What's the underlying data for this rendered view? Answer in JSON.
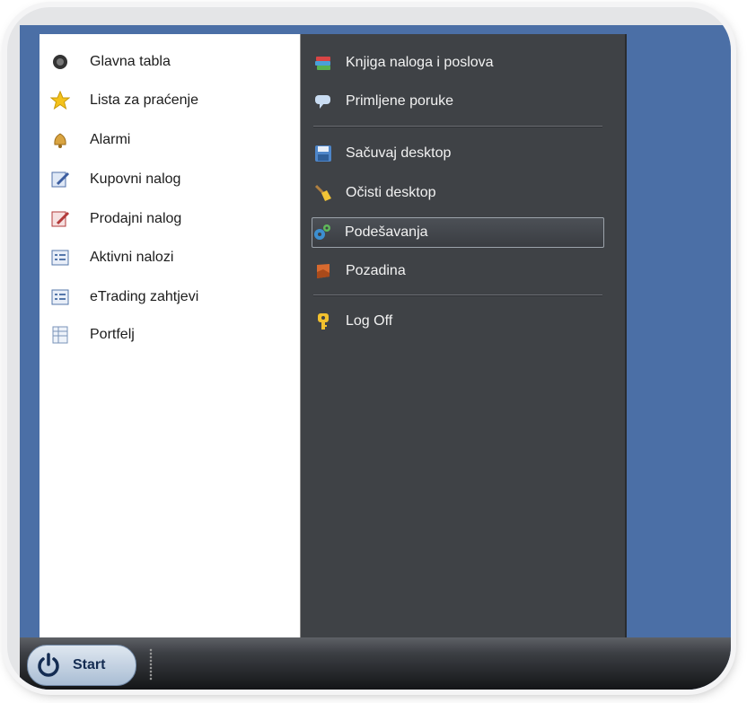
{
  "start_menu": {
    "left_items": [
      {
        "label": "Glavna tabla",
        "icon": "dashboard-icon"
      },
      {
        "label": "Lista za praćenje",
        "icon": "star-icon"
      },
      {
        "label": "Alarmi",
        "icon": "bell-icon"
      },
      {
        "label": "Kupovni nalog",
        "icon": "buy-order-icon"
      },
      {
        "label": "Prodajni nalog",
        "icon": "sell-order-icon"
      },
      {
        "label": "Aktivni nalozi",
        "icon": "active-orders-icon"
      },
      {
        "label": "eTrading zahtjevi",
        "icon": "etrading-requests-icon"
      },
      {
        "label": "Portfelj",
        "icon": "portfolio-icon"
      }
    ],
    "right_items": [
      {
        "label": "Knjiga naloga i poslova",
        "icon": "books-icon"
      },
      {
        "label": "Primljene poruke",
        "icon": "speech-bubble-icon"
      },
      {
        "label": "Sačuvaj desktop",
        "icon": "floppy-disk-icon"
      },
      {
        "label": "Očisti desktop",
        "icon": "broom-icon"
      },
      {
        "label": "Podešavanja",
        "icon": "gears-icon",
        "selected": true
      },
      {
        "label": "Pozadina",
        "icon": "wallpaper-icon"
      },
      {
        "label": "Log Off",
        "icon": "key-icon"
      }
    ]
  },
  "taskbar": {
    "start_label": "Start",
    "start_icon": "power-icon"
  },
  "colors": {
    "desktop": "#4b6fa6",
    "menu_dark": "#3f4246",
    "menu_light": "#ffffff",
    "taskbar": "#141517"
  }
}
